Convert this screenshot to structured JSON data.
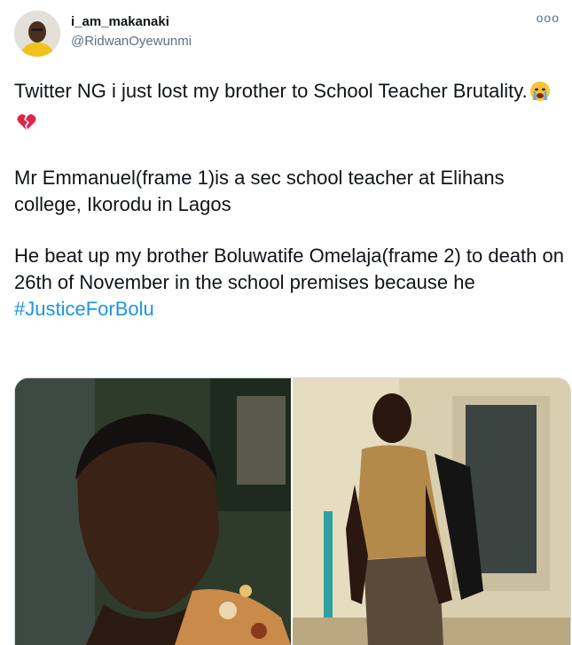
{
  "user": {
    "display_name": "i_am_makanaki",
    "handle": "@RidwanOyewunmi"
  },
  "more_button": "ooo",
  "tweet": {
    "line1": "Twitter NG i just lost my brother to School Teacher Brutality.",
    "emojis": [
      "crying-face-emoji",
      "broken-heart-emoji"
    ],
    "para2": "Mr Emmanuel(frame 1)is a sec school teacher at Elihans college, Ikorodu in Lagos",
    "para3": "He beat up my brother Boluwatife Omelaja(frame 2) to death on 26th of November in the school premises because he",
    "hashtag": "#JusticeForBolu"
  },
  "colors": {
    "link": "#1b95e0",
    "muted": "#5b7083",
    "text": "#0f1419"
  },
  "media": {
    "count": 2
  }
}
